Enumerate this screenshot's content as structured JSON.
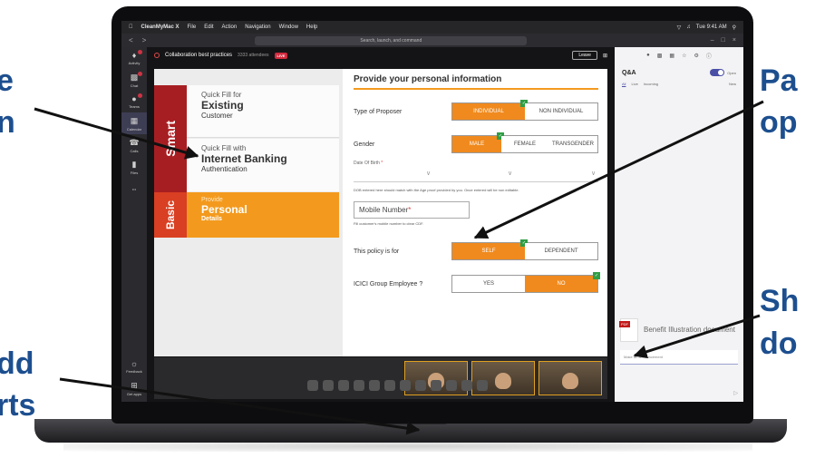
{
  "callouts": [
    {
      "text": "e"
    },
    {
      "text": "n"
    },
    {
      "text": "Pa"
    },
    {
      "text": "op"
    },
    {
      "text": "Sh"
    },
    {
      "text": "do"
    },
    {
      "text": "dd"
    },
    {
      "text": "rts"
    }
  ],
  "menubar": {
    "apple": "",
    "app": "CleanMyMac X",
    "items": [
      "File",
      "Edit",
      "Action",
      "Navigation",
      "Window",
      "Help"
    ],
    "clock": "Tue 9:41 AM"
  },
  "titlebar": {
    "back": "<",
    "forward": ">",
    "search_placeholder": "Search, launch, and command",
    "minimize": "–",
    "maximize": "□",
    "close": "×"
  },
  "rail": [
    "Activity",
    "Chat",
    "Teams",
    "Calendar",
    "Calls",
    "Files",
    "•••",
    "Feedback",
    "Get apps"
  ],
  "meeting": {
    "title": "Collaboration best practices",
    "attendees": "3333 attendees",
    "live": "LIVE",
    "leave": "Leave"
  },
  "smart": "Smart",
  "basic": "Basic",
  "quickfill1": {
    "small": "Quick Fill for",
    "big": "Existing",
    "sub": "Customer"
  },
  "quickfill2": {
    "small": "Quick Fill with",
    "big": "Internet Banking",
    "sub": "Authentication"
  },
  "provide": {
    "small": "Provide",
    "big": "Personal",
    "sub": "Details"
  },
  "form": {
    "title": "Provide your personal information",
    "proposer": {
      "label": "Type of Proposer",
      "opt1": "INDIVIDUAL",
      "opt2": "NON INDIVIDUAL"
    },
    "gender": {
      "label": "Gender",
      "opt1": "MALE",
      "opt2": "FEMALE",
      "opt3": "TRANSGENDER"
    },
    "dob": {
      "label": "Date Of Birth",
      "required": "*"
    },
    "dob_note": "DOB entered here should match with the Age proof provided by you. Once entered will be non editable.",
    "mobile": {
      "label": "Mobile Number",
      "required": "*"
    },
    "mobile_note": "Fill customer's mobile number to clear CDF.",
    "policy": {
      "label": "This policy is for",
      "opt1": "SELF",
      "opt2": "DEPENDENT"
    },
    "employee": {
      "label": "ICICI Group Employee ?",
      "opt1": "YES",
      "opt2": "NO"
    }
  },
  "qa": {
    "title": "Q&A",
    "open": "Open",
    "tabs": [
      "All",
      "Live",
      "Incoming"
    ],
    "new": "New"
  },
  "document": {
    "name": "Benefit Illustration document"
  },
  "announce_placeholder": "Make an announcement",
  "icons": {
    "chevron": "∨",
    "send": "▷"
  }
}
